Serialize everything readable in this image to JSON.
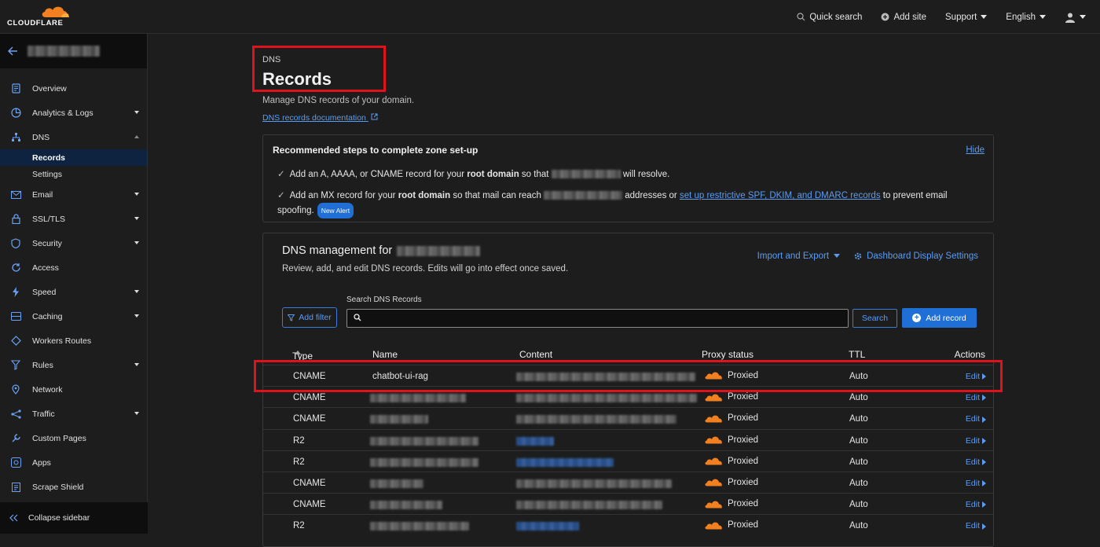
{
  "topbar": {
    "brand": "CLOUDFLARE",
    "quick_search": "Quick search",
    "add_site": "Add site",
    "support": "Support",
    "language": "English"
  },
  "sidebar": {
    "items": [
      {
        "label": "Overview",
        "icon": "document-icon"
      },
      {
        "label": "Analytics & Logs",
        "icon": "chart-icon"
      },
      {
        "label": "DNS",
        "icon": "network-icon"
      },
      {
        "label": "Email",
        "icon": "mail-icon"
      },
      {
        "label": "SSL/TLS",
        "icon": "lock-icon"
      },
      {
        "label": "Security",
        "icon": "shield-icon"
      },
      {
        "label": "Access",
        "icon": "refresh-icon"
      },
      {
        "label": "Speed",
        "icon": "bolt-icon"
      },
      {
        "label": "Caching",
        "icon": "drive-icon"
      },
      {
        "label": "Workers Routes",
        "icon": "diamond-icon"
      },
      {
        "label": "Rules",
        "icon": "funnel-icon"
      },
      {
        "label": "Network",
        "icon": "pin-icon"
      },
      {
        "label": "Traffic",
        "icon": "share-icon"
      },
      {
        "label": "Custom Pages",
        "icon": "wrench-icon"
      },
      {
        "label": "Apps",
        "icon": "apps-icon"
      },
      {
        "label": "Scrape Shield",
        "icon": "clipboard-icon"
      }
    ],
    "dns_sub": [
      "Records",
      "Settings"
    ],
    "collapse": "Collapse sidebar"
  },
  "page": {
    "breadcrumb": "DNS",
    "title": "Records",
    "subtitle": "Manage DNS records of your domain.",
    "doc_link": "DNS records documentation"
  },
  "setup": {
    "heading": "Recommended steps to complete zone set-up",
    "hide": "Hide",
    "step1_a": "Add an A, AAAA, or CNAME record for your ",
    "step1_b": "root domain",
    "step1_c": " so that ",
    "step1_d": " will resolve.",
    "step2_a": "Add an MX record for your ",
    "step2_b": "root domain",
    "step2_c": " so that mail can reach ",
    "step2_d": " addresses or ",
    "step2_link": "set up restrictive SPF, DKIM, and DMARC records",
    "step2_e": " to prevent email spoofing.",
    "badge": "New Alert"
  },
  "dns": {
    "heading": "DNS management for",
    "description": "Review, add, and edit DNS records. Edits will go into effect once saved.",
    "import_export": "Import and Export",
    "display_settings": "Dashboard Display Settings",
    "add_filter": "Add filter",
    "search_label": "Search DNS Records",
    "search_placeholder": "",
    "search_button": "Search",
    "add_record": "Add record",
    "columns": [
      "Type",
      "Name",
      "Content",
      "Proxy status",
      "TTL",
      "Actions"
    ],
    "rows": [
      {
        "type": "CNAME",
        "name": "chatbot-ui-rag",
        "proxy": "Proxied",
        "ttl": "Auto",
        "action": "Edit"
      },
      {
        "type": "CNAME",
        "name": "",
        "proxy": "Proxied",
        "ttl": "Auto",
        "action": "Edit"
      },
      {
        "type": "CNAME",
        "name": "",
        "proxy": "Proxied",
        "ttl": "Auto",
        "action": "Edit"
      },
      {
        "type": "R2",
        "name": "",
        "proxy": "Proxied",
        "ttl": "Auto",
        "action": "Edit"
      },
      {
        "type": "R2",
        "name": "",
        "proxy": "Proxied",
        "ttl": "Auto",
        "action": "Edit"
      },
      {
        "type": "CNAME",
        "name": "",
        "proxy": "Proxied",
        "ttl": "Auto",
        "action": "Edit"
      },
      {
        "type": "CNAME",
        "name": "",
        "proxy": "Proxied",
        "ttl": "Auto",
        "action": "Edit"
      },
      {
        "type": "R2",
        "name": "",
        "proxy": "Proxied",
        "ttl": "Auto",
        "action": "Edit"
      }
    ]
  },
  "colors": {
    "accent": "#5b9cf2",
    "primary_button": "#1f6fd6",
    "highlight_box": "#e0121b",
    "cloud_orange": "#f38020"
  }
}
